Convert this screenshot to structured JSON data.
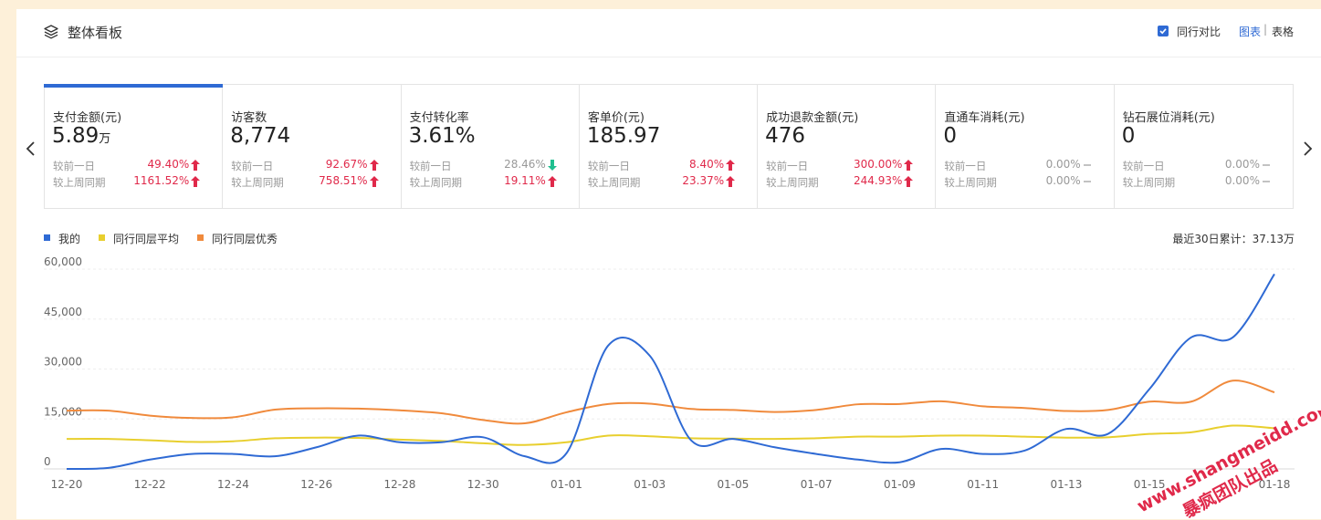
{
  "header": {
    "title": "整体看板",
    "compare_label": "同行对比",
    "view_chart": "图表",
    "view_table": "表格",
    "separator": "|"
  },
  "cards": [
    {
      "label": "支付金额(元)",
      "value": "5.89",
      "unit": "万",
      "cmp1_label": "较前一日",
      "cmp1_pct": "49.40%",
      "cmp1_dir": "up",
      "cmp2_label": "较上周同期",
      "cmp2_pct": "1161.52%",
      "cmp2_dir": "up"
    },
    {
      "label": "访客数",
      "value": "8,774",
      "unit": "",
      "cmp1_label": "较前一日",
      "cmp1_pct": "92.67%",
      "cmp1_dir": "up",
      "cmp2_label": "较上周同期",
      "cmp2_pct": "758.51%",
      "cmp2_dir": "up"
    },
    {
      "label": "支付转化率",
      "value": "3.61%",
      "unit": "",
      "cmp1_label": "较前一日",
      "cmp1_pct": "28.46%",
      "cmp1_dir": "down",
      "cmp2_label": "较上周同期",
      "cmp2_pct": "19.11%",
      "cmp2_dir": "up"
    },
    {
      "label": "客单价(元)",
      "value": "185.97",
      "unit": "",
      "cmp1_label": "较前一日",
      "cmp1_pct": "8.40%",
      "cmp1_dir": "up",
      "cmp2_label": "较上周同期",
      "cmp2_pct": "23.37%",
      "cmp2_dir": "up"
    },
    {
      "label": "成功退款金额(元)",
      "value": "476",
      "unit": "",
      "cmp1_label": "较前一日",
      "cmp1_pct": "300.00%",
      "cmp1_dir": "up",
      "cmp2_label": "较上周同期",
      "cmp2_pct": "244.93%",
      "cmp2_dir": "up"
    },
    {
      "label": "直通车消耗(元)",
      "value": "0",
      "unit": "",
      "cmp1_label": "较前一日",
      "cmp1_pct": "0.00%",
      "cmp1_dir": "flat",
      "cmp2_label": "较上周同期",
      "cmp2_pct": "0.00%",
      "cmp2_dir": "flat"
    },
    {
      "label": "钻石展位消耗(元)",
      "value": "0",
      "unit": "",
      "cmp1_label": "较前一日",
      "cmp1_pct": "0.00%",
      "cmp1_dir": "flat",
      "cmp2_label": "较上周同期",
      "cmp2_pct": "0.00%",
      "cmp2_dir": "flat"
    }
  ],
  "legend": {
    "mine": "我的",
    "avg": "同行同层平均",
    "excellent": "同行同层优秀"
  },
  "total_label": "最近30日累计：37.13万",
  "colors": {
    "accent": "#2f6ad4",
    "mine": "#2f6ad4",
    "avg": "#e8cf2e",
    "excellent": "#f08a3c",
    "up": "#e0294a",
    "down": "#1fbf8f"
  },
  "icons": {
    "title": "layers-icon",
    "nav_left": "chevron-left-icon",
    "nav_right": "chevron-right-icon",
    "up": "arrow-up-icon",
    "down": "arrow-down-icon",
    "flat": "dash-icon"
  },
  "watermark": {
    "line1": "www.shangmeidd.com",
    "line2": "暴疯团队出品"
  },
  "chart_data": {
    "type": "line",
    "x": [
      "12-20",
      "12-21",
      "12-22",
      "12-23",
      "12-24",
      "12-25",
      "12-26",
      "12-27",
      "12-28",
      "12-29",
      "12-30",
      "12-31",
      "01-01",
      "01-02",
      "01-03",
      "01-04",
      "01-05",
      "01-06",
      "01-07",
      "01-08",
      "01-09",
      "01-10",
      "01-11",
      "01-12",
      "01-13",
      "01-14",
      "01-15",
      "01-16",
      "01-17",
      "01-18"
    ],
    "x_ticks": [
      "12-20",
      "12-22",
      "12-24",
      "12-26",
      "12-28",
      "12-30",
      "01-01",
      "01-03",
      "01-05",
      "01-07",
      "01-09",
      "01-11",
      "01-13",
      "01-15",
      "01-18"
    ],
    "y_ticks": [
      "0",
      "15,000",
      "30,000",
      "45,000",
      "60,000"
    ],
    "ylim": [
      0,
      60000
    ],
    "grid": true,
    "legend_position": "top-left",
    "series": [
      {
        "name": "我的",
        "color": "#2f6ad4",
        "values": [
          0,
          300,
          2800,
          4500,
          4500,
          3800,
          6500,
          10000,
          8000,
          8000,
          9500,
          3800,
          4700,
          37000,
          34000,
          8500,
          9000,
          6500,
          4500,
          2800,
          2000,
          6000,
          4500,
          5500,
          12000,
          10500,
          24000,
          39500,
          39500,
          58500
        ]
      },
      {
        "name": "同行同层平均",
        "color": "#e8cf2e",
        "values": [
          9000,
          9000,
          8600,
          8100,
          8300,
          9200,
          9400,
          9300,
          8800,
          8400,
          7700,
          7200,
          8000,
          10000,
          9800,
          9200,
          9100,
          9000,
          9200,
          9700,
          9700,
          10000,
          10000,
          9700,
          9400,
          9500,
          10500,
          11000,
          13000,
          12200
        ]
      },
      {
        "name": "同行同层优秀",
        "color": "#f08a3c",
        "values": [
          17500,
          17500,
          16000,
          15300,
          15500,
          17800,
          18200,
          18100,
          17600,
          16700,
          14700,
          13700,
          17000,
          19500,
          19600,
          18000,
          17700,
          17100,
          17700,
          19400,
          19500,
          20300,
          18800,
          18300,
          17400,
          17700,
          20200,
          20200,
          26500,
          23000
        ]
      }
    ]
  }
}
